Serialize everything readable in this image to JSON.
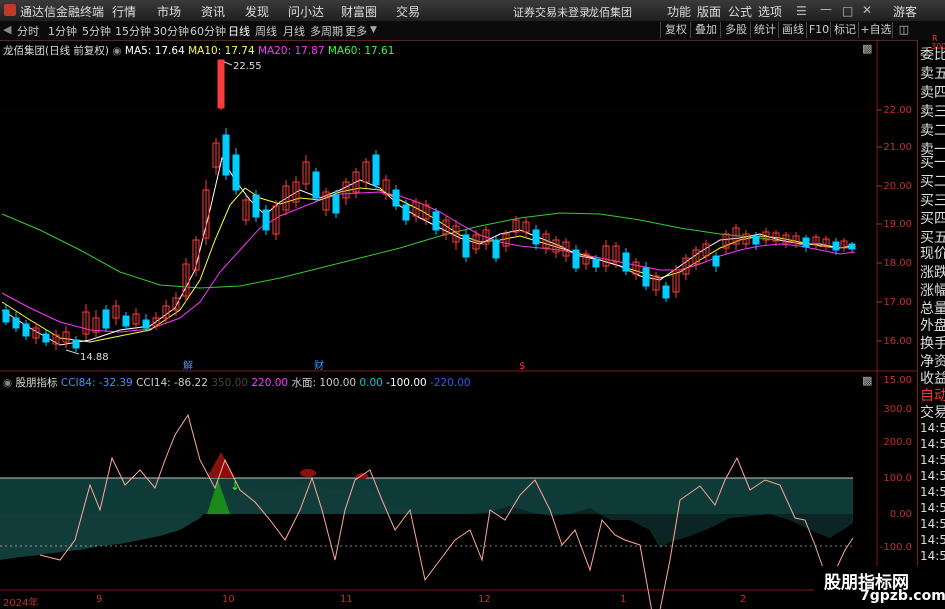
{
  "menubar": {
    "app_title": "通达信金融终端",
    "items": [
      "行情",
      "市场",
      "资讯",
      "发现",
      "问小达",
      "财富圈",
      "交易"
    ],
    "notice": "证券交易未登录",
    "stock_name": "龙佰集团",
    "right_items": [
      "功能",
      "版面",
      "公式",
      "选项"
    ],
    "guest": "游客"
  },
  "toolbar": {
    "periods": [
      "分时",
      "1分钟",
      "5分钟",
      "15分钟",
      "30分钟",
      "60分钟",
      "日线",
      "周线",
      "月线",
      "多周期",
      "更多"
    ],
    "selected": "日线",
    "right_buttons": [
      "复权",
      "叠加",
      "多股",
      "统计",
      "画线",
      "F10",
      "标记",
      "+自选"
    ]
  },
  "main_chart": {
    "title": "龙佰集团(日线 前复权)",
    "ma": [
      {
        "label": "MA5: 17.64",
        "color": "#ffffff"
      },
      {
        "label": "MA10: 17.74",
        "color": "#ffff33"
      },
      {
        "label": "MA20: 17.87",
        "color": "#ff33ff"
      },
      {
        "label": "MA60: 17.61",
        "color": "#33ff33"
      }
    ],
    "high_label": "22.55",
    "low_label": "14.88",
    "price_ticks": [
      "22.00",
      "21.00",
      "20.00",
      "19.00",
      "18.00",
      "17.00",
      "16.00",
      "15.00"
    ],
    "markers": [
      "解",
      "财",
      "$"
    ]
  },
  "indicator": {
    "title": "股朋指标",
    "values": [
      {
        "label": "CCI84: -32.39",
        "color": "#4a8cff"
      },
      {
        "label": "CCI14: -86.22",
        "color": "#cccccc"
      },
      {
        "label": "350.00",
        "color": "#444444"
      },
      {
        "label": "220.00",
        "color": "#ff33ff"
      },
      {
        "label": "水面: 100.00",
        "color": "#cccccc"
      },
      {
        "label": "0.00",
        "color": "#00cccc"
      },
      {
        "label": "-100.00",
        "color": "#ffffff"
      },
      {
        "label": "-220.00",
        "color": "#3355ff"
      }
    ],
    "ticks": [
      "300.0",
      "200.0",
      "100.0",
      "0.00",
      "-100.0"
    ]
  },
  "x_axis": [
    "2024年",
    "9",
    "10",
    "11",
    "12",
    "1",
    "2"
  ],
  "right_panel": {
    "top_label": "R",
    "top_sub": "300",
    "items": [
      "委比",
      "卖五",
      "卖四",
      "卖三",
      "卖二",
      "卖一",
      "买一",
      "买二",
      "买三",
      "买四",
      "买五",
      "现价",
      "涨跌",
      "涨幅",
      "总量",
      "外盘",
      "换手",
      "净资",
      "收益"
    ],
    "auto": "自动",
    "trade": "交易",
    "times": [
      "14:56",
      "14:56",
      "14:56",
      "14:56",
      "14:56",
      "14:56",
      "14:56",
      "14:56",
      "14:56"
    ]
  },
  "watermark": {
    "line1": "股朋指标网",
    "line2": "7gpzb.com"
  }
}
